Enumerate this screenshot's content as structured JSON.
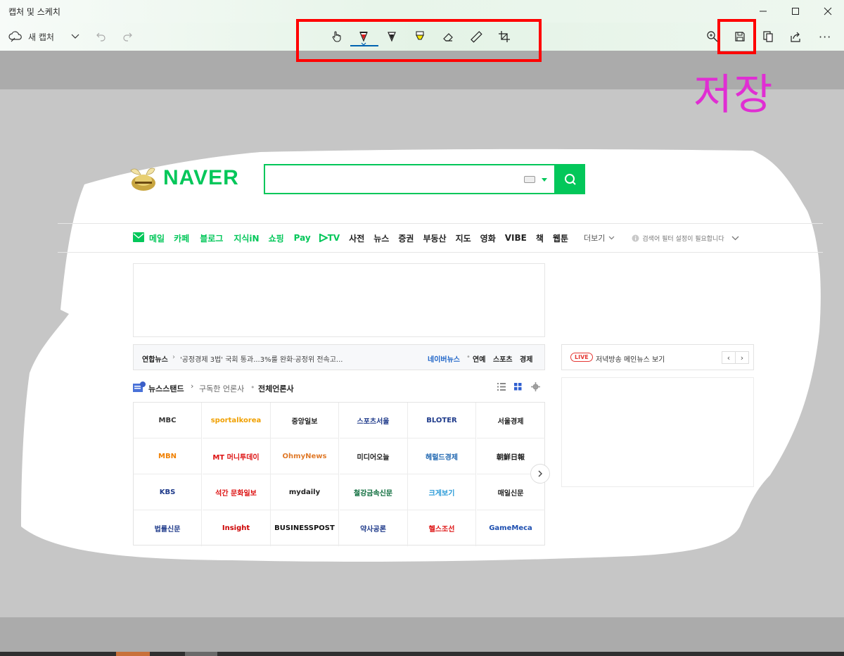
{
  "window": {
    "title": "캡처 및 스케치",
    "minimize": "—",
    "maximize": "☐",
    "close": "✕"
  },
  "commandbar": {
    "new_capture_label": "새 캡처",
    "tools": [
      {
        "name": "touch-writing-icon"
      },
      {
        "name": "ballpoint-pen-icon",
        "active": true
      },
      {
        "name": "pencil-icon"
      },
      {
        "name": "highlighter-icon"
      },
      {
        "name": "eraser-icon"
      },
      {
        "name": "ruler-icon"
      },
      {
        "name": "crop-icon"
      }
    ],
    "right": [
      "zoom-icon",
      "save-icon",
      "copy-icon",
      "share-icon",
      "more-icon"
    ],
    "more_label": "···"
  },
  "annotation": {
    "label": "저장",
    "color": "#e02ed3",
    "box_color": "#ff0000"
  },
  "naver": {
    "logo": "NAVER",
    "brand_color": "#03c75a",
    "nav_green": [
      "메일",
      "카페",
      "블로그",
      "지식iN",
      "쇼핑",
      "Pay",
      "TV"
    ],
    "nav_black": [
      "사전",
      "뉴스",
      "증권",
      "부동산",
      "지도",
      "영화",
      "VIBE",
      "책",
      "웹툰"
    ],
    "nav_more": "더보기",
    "nav_notice": "검색어 필터 설정이 필요합니다",
    "news": {
      "source": "연합뉴스",
      "headline": "'공정경제 3법' 국회 통과...3%룰 완화·공정위 전속고...",
      "naver_news": "네이버뉴스",
      "cat1": "연예",
      "cat2": "스포츠",
      "cat3": "경제"
    },
    "live": {
      "badge": "LIVE",
      "text": "저녁방송 메인뉴스 보기"
    },
    "newsstand": {
      "title": "뉴스스탠드",
      "subscribed": "구독한 언론사",
      "all": "전체언론사"
    },
    "press": [
      [
        "MBC",
        "sportalkorea",
        "중앙일보",
        "스포츠서울",
        "BLOTER",
        "서울경제"
      ],
      [
        "MBN",
        "MT 머니투데이",
        "OhmyNews",
        "미디어오늘",
        "헤럴드경제",
        "朝鮮日報"
      ],
      [
        "KBS",
        "석간 문화일보",
        "mydaily",
        "철강금속신문",
        "크게보기",
        "매일신문"
      ],
      [
        "법률신문",
        "Insight",
        "BUSINESSPOST",
        "약사공론",
        "헬스조선",
        "GameMeca"
      ]
    ],
    "press_colors": [
      [
        "#333333",
        "#f0a000",
        "#222222",
        "#1e3a8a",
        "#1e3a8a",
        "#222222"
      ],
      [
        "#f08000",
        "#d11",
        "#e07a2a",
        "#222222",
        "#1e66b0",
        "#222222"
      ],
      [
        "#1e3a8a",
        "#d11",
        "#222222",
        "#0a6b3a",
        "#2a9bd8",
        "#222222"
      ],
      [
        "#1e3a8a",
        "#c00",
        "#111111",
        "#1e3a8a",
        "#d11",
        "#1e4fb0"
      ]
    ]
  }
}
